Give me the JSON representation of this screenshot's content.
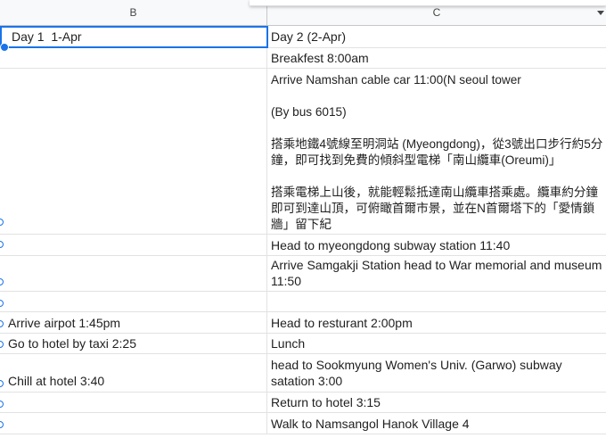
{
  "columns": {
    "b": "B",
    "c": "C"
  },
  "rows": [
    {
      "b": "Day 1  1-Apr",
      "c": "Day 2 (2-Apr)"
    },
    {
      "b": "",
      "c": "Breakfest 8:00am"
    },
    {
      "b": "",
      "c": "Arrive Namshan cable car 11:00(N seoul tower\n\n(By bus 6015)\n\n搭乘地鐵4號線至明洞站 (Myeongdong)，從3號出口步行約5分鐘，即可找到免費的傾斜型電梯「南山纜車(Oreumi)」\n\n搭乘電梯上山後，就能輕鬆抵達南山纜車搭乘處。纜車約分鐘即可到達山頂，可俯瞰首爾市景，並在N首爾塔下的「愛情鎖牆」留下紀"
    },
    {
      "b": "",
      "c": "Head to myeongdong subway station 11:40"
    },
    {
      "b": "",
      "c": "Arrive Samgakji Station head to War memorial and museum 11:50"
    },
    {
      "b": "",
      "c": ""
    },
    {
      "b": "Arrive airpot 1:45pm",
      "c": "Head to resturant 2:00pm"
    },
    {
      "b": "Go to hotel by taxi 2:25",
      "c": "Lunch"
    },
    {
      "b": "Chill at hotel 3:40",
      "c": "head to Sookmyung Women's Univ. (Garwo) subway satation 3:00"
    },
    {
      "b": "",
      "c": "Return to hotel 3:15"
    },
    {
      "b": "",
      "c": "Walk to Namsangol Hanok Village 4"
    }
  ]
}
